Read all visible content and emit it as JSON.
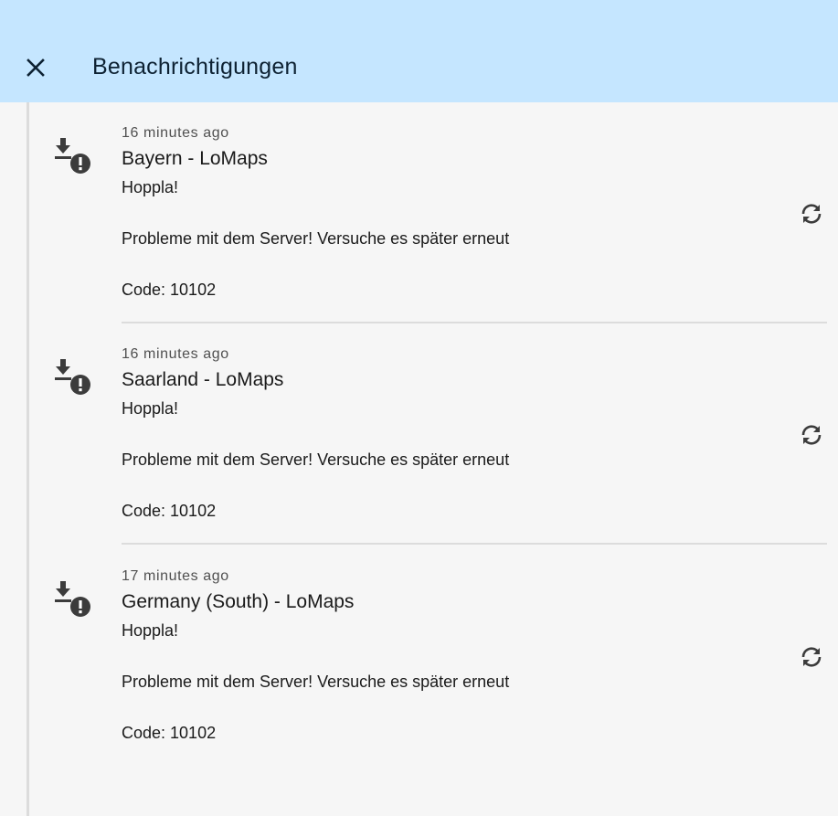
{
  "appbar": {
    "title": "Benachrichtigungen",
    "close_icon": "close-icon"
  },
  "notifications": [
    {
      "time": "16 minutes ago",
      "title": "Bayern - LoMaps",
      "line1": "Hoppla!",
      "line2": "Probleme mit dem Server! Versuche es später erneut",
      "line3": "Code: 10102",
      "icon": "download-error-icon",
      "action_icon": "retry-icon"
    },
    {
      "time": "16 minutes ago",
      "title": "Saarland - LoMaps",
      "line1": "Hoppla!",
      "line2": "Probleme mit dem Server! Versuche es später erneut",
      "line3": "Code: 10102",
      "icon": "download-error-icon",
      "action_icon": "retry-icon"
    },
    {
      "time": "17 minutes ago",
      "title": "Germany (South) - LoMaps",
      "line1": "Hoppla!",
      "line2": "Probleme mit dem Server! Versuche es später erneut",
      "line3": "Code: 10102",
      "icon": "download-error-icon",
      "action_icon": "retry-icon"
    }
  ],
  "colors": {
    "appbar_bg": "#c5e6ff",
    "page_bg": "#f6f6f6",
    "icon": "#3c3c3c",
    "divider": "#dcdcdc"
  }
}
